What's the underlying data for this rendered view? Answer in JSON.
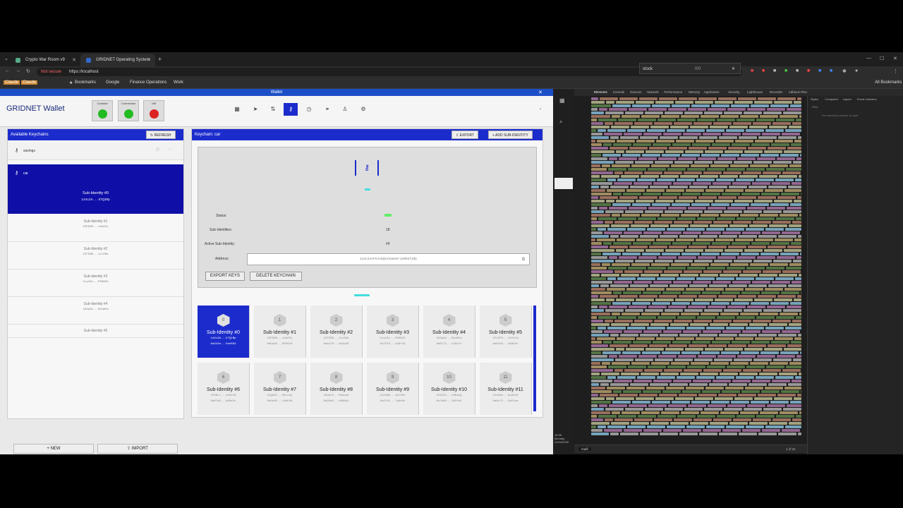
{
  "browser": {
    "tabs": [
      {
        "label": "Crypto War Room v9"
      },
      {
        "label": "GRIDNET Operating System"
      }
    ],
    "security_label": "Not secure",
    "url": "https://localhost",
    "bookmarks": [
      "Claude",
      "Claude",
      "Bookmarks",
      "Google",
      "Finance Operations",
      "Work"
    ],
    "all_bookmarks": "All Bookmarks",
    "find_query": "stock",
    "find_count": "0/0"
  },
  "window": {
    "title": "Wallet"
  },
  "header": {
    "app_title": "GRIDNET Wallet",
    "indicators": [
      {
        "label": "Contract",
        "color": "#22bb22"
      },
      {
        "label": "Connection",
        "color": "#22bb22"
      },
      {
        "label": "VM",
        "color": "#dd2222"
      }
    ]
  },
  "left_panel": {
    "title": "Available Keychains",
    "refresh_label": "REFRESH",
    "keychains": [
      {
        "name": "savings"
      },
      {
        "name": "car"
      }
    ],
    "active_sub": {
      "name": "Sub-Identity #0",
      "address": "144c2A...kTQ1Mp"
    },
    "subs": [
      {
        "name": "Sub-Identity #1",
        "address": "1PE5EB...zUuHfy"
      },
      {
        "name": "Sub-Identity #2",
        "address": "1CF5SB...JLtSOb"
      },
      {
        "name": "Sub-Identity #3",
        "address": "1tyC6n...P5H8Z2"
      },
      {
        "name": "Sub-Identity #4",
        "address": "1K3a3o...Bs1Wfw"
      },
      {
        "name": "Sub-Identity #5",
        "address": ""
      }
    ],
    "new_label": "NEW",
    "import_label": "IMPORT"
  },
  "right_panel": {
    "title": "Keychain: car",
    "export_label": "EXPORT",
    "add_sub_label": "ADD SUB-IDENTITY",
    "status_label": "Status:",
    "sub_identities_label": "Sub-Identities:",
    "sub_identities_value": "18",
    "active_sub_label": "Active Sub-Identity:",
    "active_sub_value": "#0",
    "address_label": "Address:",
    "address_value": "144c2AoF5JsGQXvSa8nKrzpMkKT1Mp",
    "export_keys_label": "EXPORT KEYS",
    "delete_keychain_label": "DELETE KEYCHAIN",
    "cards": [
      {
        "idx": "0",
        "name": "Sub-Identity #0",
        "a1": "144c2A...kTQ1Mp",
        "a2": "0a316d...5ee882"
      },
      {
        "idx": "1",
        "name": "Sub-Identity #1",
        "a1": "1PE5EB...zUuHfy",
        "a2": "0a5a30...8E0018"
      },
      {
        "idx": "2",
        "name": "Sub-Identity #2",
        "a1": "1CF5SB...JLtSOb",
        "a2": "0aa170...a04a38"
      },
      {
        "idx": "3",
        "name": "Sub-Identity #3",
        "a1": "1tyC6n...P5H8Z2",
        "a2": "0a7F53...4d6f19"
      },
      {
        "idx": "4",
        "name": "Sub-Identity #4",
        "a1": "1K3a3o...Bs1Wfw",
        "a2": "0a6174...e3dc47"
      },
      {
        "idx": "5",
        "name": "Sub-Identity #5",
        "a1": "1FcFP8...nSTaTm",
        "a2": "0a6d26...03db5c"
      },
      {
        "idx": "6",
        "name": "Sub-Identity #6",
        "a1": "1EXBrL...b4Sxf8",
        "a2": "0a67a9...a96e3c"
      },
      {
        "idx": "7",
        "name": "Sub-Identity #7",
        "a1": "12QH3C...NFxxdy",
        "a2": "0a5e00...d4a546"
      },
      {
        "idx": "8",
        "name": "Sub-Identity #8",
        "a1": "1EwoF2...D5mxwS",
        "a2": "0a39a0...d86Ab4"
      },
      {
        "idx": "9",
        "name": "Sub-Identity #9",
        "a1": "12dvWG...sEcVDs",
        "a2": "0a47b5...7a6e9c"
      },
      {
        "idx": "10",
        "name": "Sub-Identity #10",
        "a1": "1E3ZCE...F6b4pQ",
        "a2": "0a7a00...2b3fe5"
      },
      {
        "idx": "11",
        "name": "Sub-Identity #11",
        "a1": "12d4Ha...Bsd5nD",
        "a2": "0a8c72...9a51ea"
      }
    ]
  },
  "devtools": {
    "tabs": [
      "Elements",
      "Console",
      "Sources",
      "Network",
      "Performance",
      "Memory",
      "Application",
      "Security",
      "Lighthouse",
      "Recorder",
      "Adblock Plus"
    ],
    "styles_tabs": [
      "Styles",
      "Computed",
      "Layout",
      "Event Listeners"
    ],
    "filter_placeholder": "Filter",
    "no_element": "No matching selector or style",
    "search_value": "mutil",
    "search_count": "1 of 21"
  },
  "taskbar": {
    "time": "19:35",
    "day": "Monday",
    "date": "21/04/2025"
  }
}
